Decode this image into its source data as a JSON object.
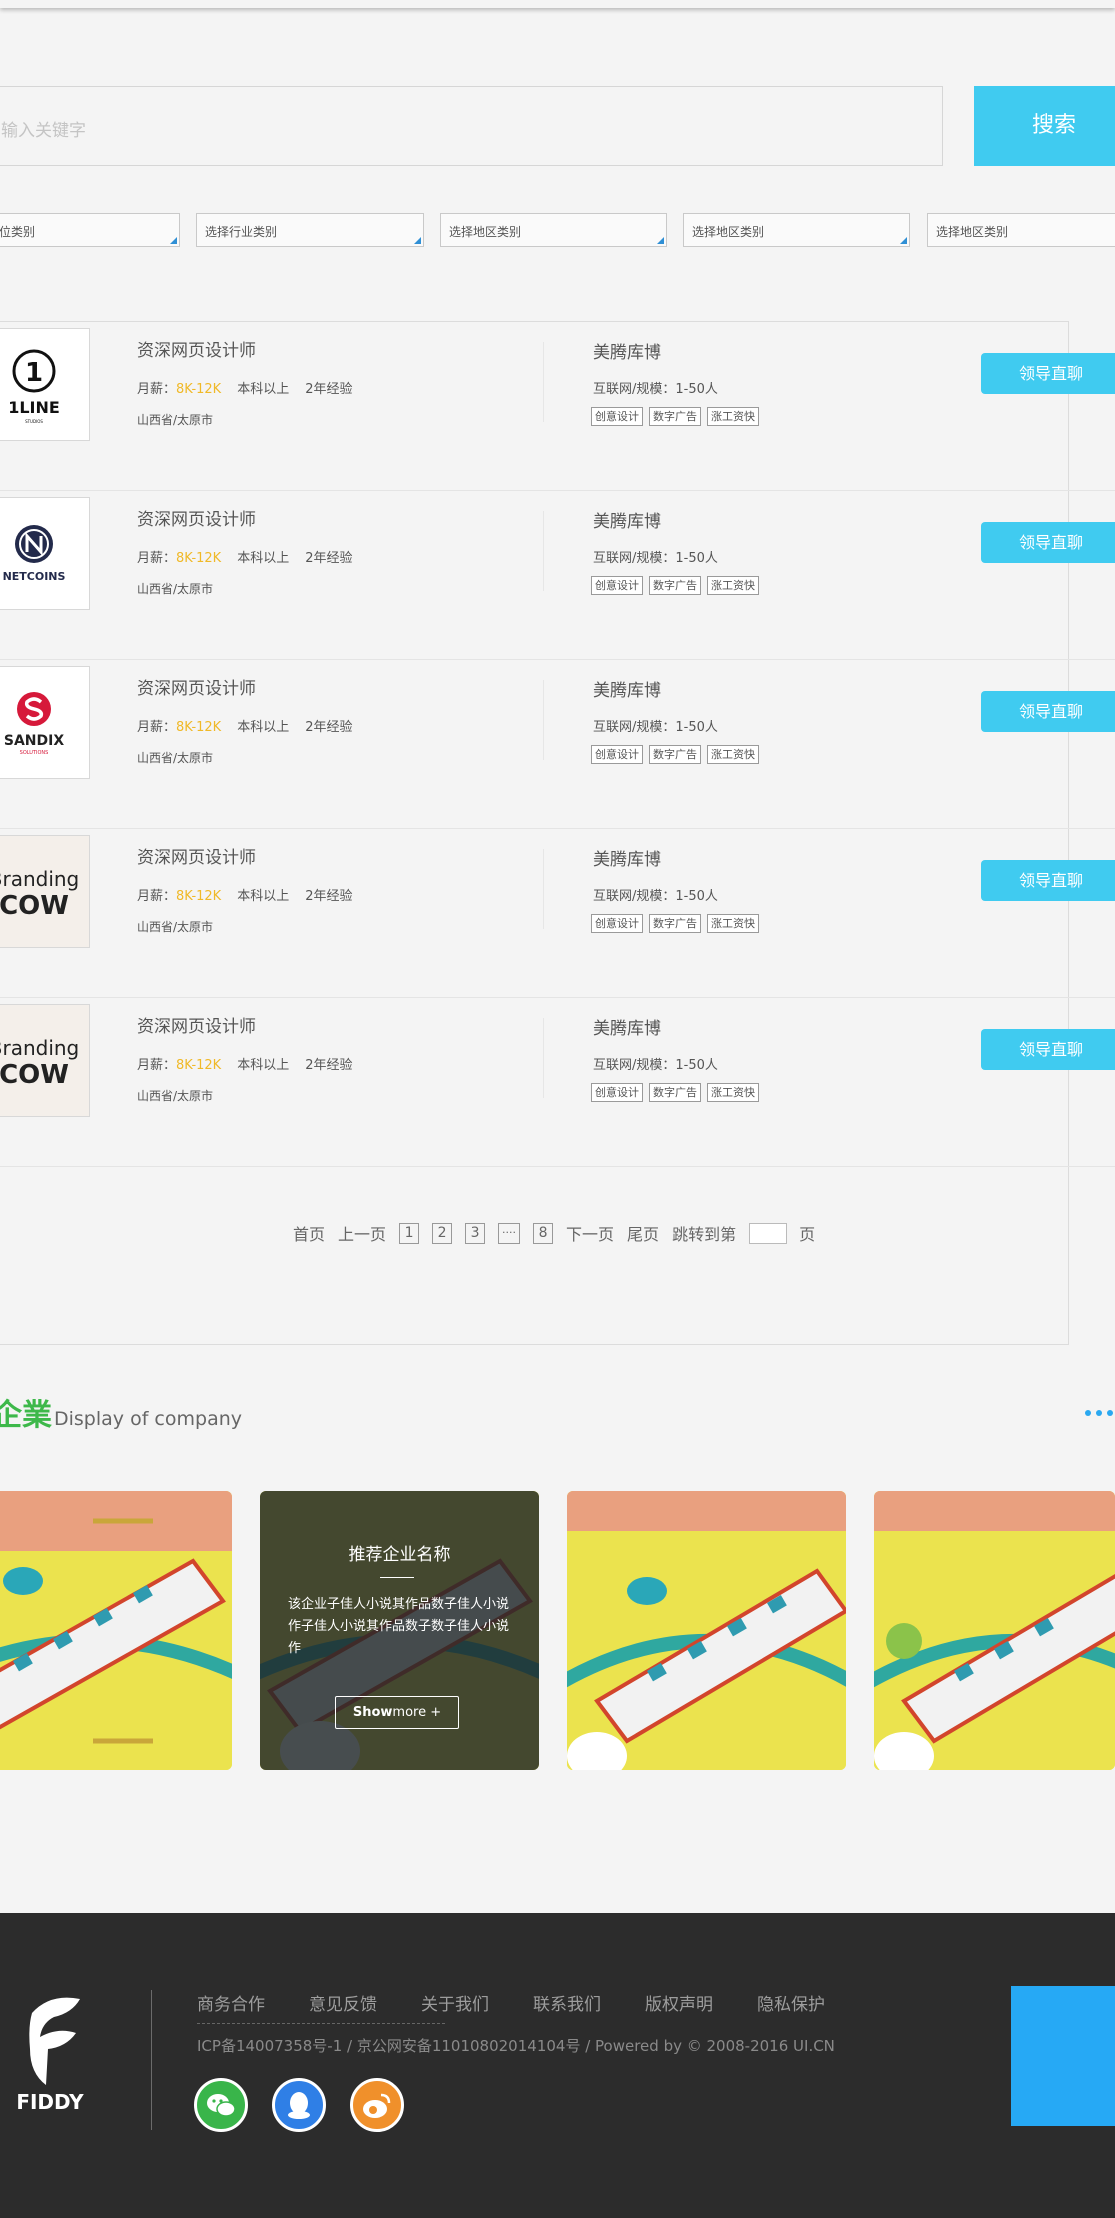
{
  "search": {
    "placeholder": "输入关键字",
    "button": "搜索"
  },
  "filters": [
    {
      "label": "位类别"
    },
    {
      "label": "选择行业类别"
    },
    {
      "label": "选择地区类别"
    },
    {
      "label": "选择地区类别"
    },
    {
      "label": "选择地区类别"
    }
  ],
  "jobs": [
    {
      "logo": "1LINE studio logo",
      "title": "资深网页设计师",
      "salary_prefix": "月薪：",
      "salary": "8K-12K",
      "education": "本科以上",
      "experience": "2年经验",
      "location": "山西省/太原市",
      "company": "美腾库博",
      "industry": "互联网/规模：1-50人",
      "tags": [
        "创意设计",
        "数字广告",
        "涨工资快"
      ],
      "button": "领导直聊"
    },
    {
      "logo": "NETCOINS logo",
      "title": "资深网页设计师",
      "salary_prefix": "月薪：",
      "salary": "8K-12K",
      "education": "本科以上",
      "experience": "2年经验",
      "location": "山西省/太原市",
      "company": "美腾库博",
      "industry": "互联网/规模：1-50人",
      "tags": [
        "创意设计",
        "数字广告",
        "涨工资快"
      ],
      "button": "领导直聊"
    },
    {
      "logo": "SANDIX logo",
      "title": "资深网页设计师",
      "salary_prefix": "月薪：",
      "salary": "8K-12K",
      "education": "本科以上",
      "experience": "2年经验",
      "location": "山西省/太原市",
      "company": "美腾库博",
      "industry": "互联网/规模：1-50人",
      "tags": [
        "创意设计",
        "数字广告",
        "涨工资快"
      ],
      "button": "领导直聊"
    },
    {
      "logo": "Branding Cow logo",
      "title": "资深网页设计师",
      "salary_prefix": "月薪：",
      "salary": "8K-12K",
      "education": "本科以上",
      "experience": "2年经验",
      "location": "山西省/太原市",
      "company": "美腾库博",
      "industry": "互联网/规模：1-50人",
      "tags": [
        "创意设计",
        "数字广告",
        "涨工资快"
      ],
      "button": "领导直聊"
    },
    {
      "logo": "Branding Cow logo",
      "title": "资深网页设计师",
      "salary_prefix": "月薪：",
      "salary": "8K-12K",
      "education": "本科以上",
      "experience": "2年经验",
      "location": "山西省/太原市",
      "company": "美腾库博",
      "industry": "互联网/规模：1-50人",
      "tags": [
        "创意设计",
        "数字广告",
        "涨工资快"
      ],
      "button": "领导直聊"
    }
  ],
  "logo_text": {
    "oneline": "1LINE",
    "oneline_sub": "STUDIOS",
    "netcoins": "NETCOINS",
    "sandix": "SANDIX",
    "sandix_sub": "SOLUTIONS",
    "branding": "Branding",
    "cow": "COW"
  },
  "pagination": {
    "first": "首页",
    "prev": "上一页",
    "pages": [
      "1",
      "2",
      "3",
      "····",
      "8"
    ],
    "next": "下一页",
    "last": "尾页",
    "jump_prefix": "跳转到第",
    "jump_suffix": "页"
  },
  "companies_section": {
    "title_zh": "企業",
    "title_en": "Display of  company",
    "featured": {
      "name": "推荐企业名称",
      "description": "该企业子佳人小说其作品数子佳人小说作子佳人小说其作品数子数子佳人小说作",
      "button_bold": "Show",
      "button_rest": "more  +"
    }
  },
  "footer": {
    "brand": "FIDDY",
    "links": [
      "商务合作",
      "意见反馈",
      "关于我们",
      "联系我们",
      "版权声明",
      "隐私保护"
    ],
    "copyright": "ICP备14007358号-1 / 京公网安备11010802014104号 / Powered by © 2008-2016 UI.CN",
    "social": [
      "wechat-icon",
      "qq-icon",
      "weibo-icon"
    ]
  },
  "colors": {
    "accent": "#40cbf0",
    "salary": "#f0b928",
    "section_title": "#3db84a",
    "footer_bg": "#2c2c2c",
    "footer_blue": "#26a9f5"
  }
}
